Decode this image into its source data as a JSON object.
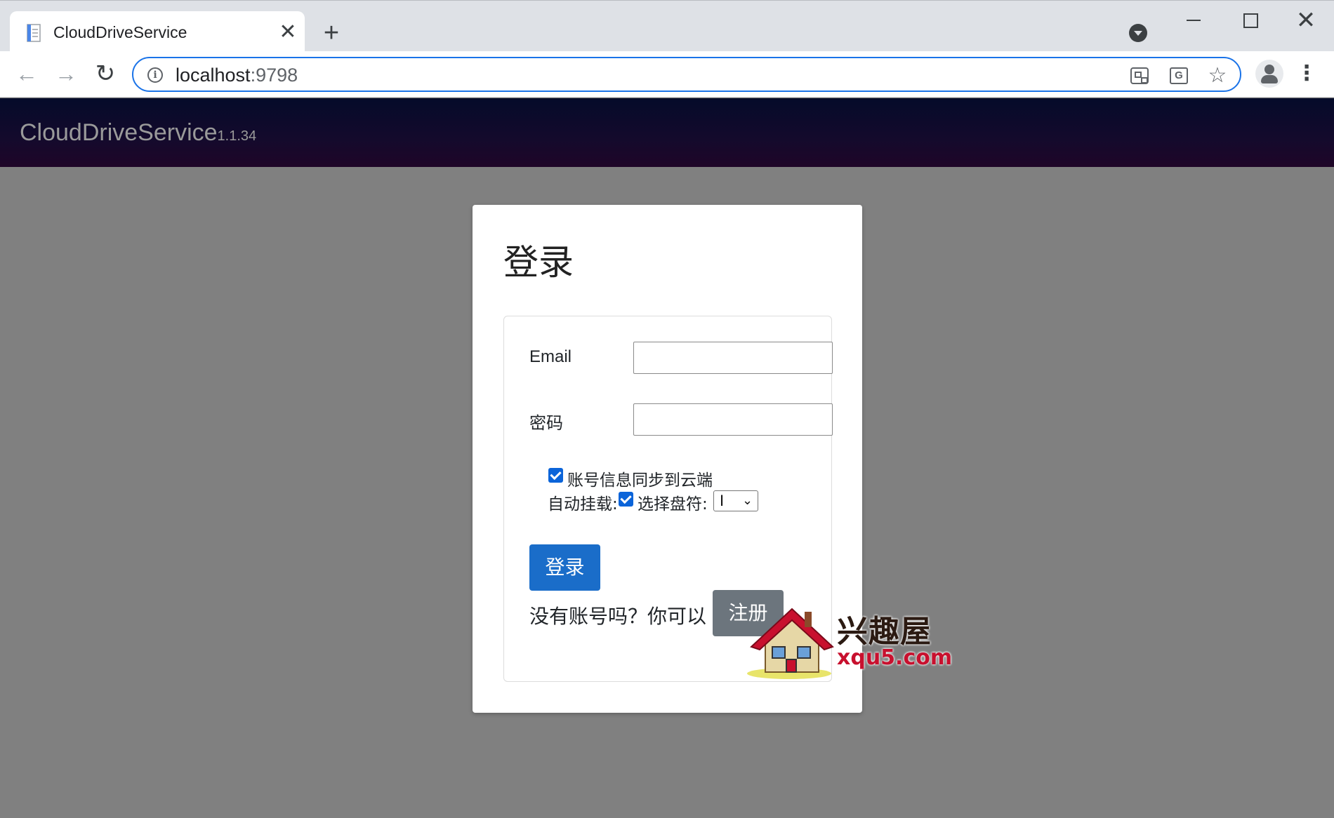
{
  "browser": {
    "tab_title": "CloudDriveService",
    "tab_close": "✕",
    "new_tab": "+",
    "url_host": "localhost",
    "url_port": ":9798",
    "window_close": "✕",
    "nav_back": "←",
    "nav_forward": "→",
    "nav_reload": "↻",
    "star": "☆",
    "kebab": "⋮",
    "info": "i",
    "translate": "G"
  },
  "header": {
    "brand": "CloudDriveService",
    "version": "1.1.34",
    "background": "#0a0a2a"
  },
  "login": {
    "title": "登录",
    "email_label": "Email",
    "email_value": "",
    "password_label": "密码",
    "password_value": "",
    "sync_label": "账号信息同步到云端",
    "sync_checked": true,
    "auto_mount_label": "自动挂载:",
    "auto_mount_checked": true,
    "drive_label": "选择盘符:",
    "drive_value": "I",
    "drive_caret": "⌄",
    "login_button": "登录",
    "no_account_text": "没有账号吗？你可以",
    "register_button": "注册",
    "primary_color": "#1a6dc9",
    "secondary_color": "#6c757d"
  },
  "watermark": {
    "text": "兴趣屋",
    "url": "xqu5.com"
  }
}
